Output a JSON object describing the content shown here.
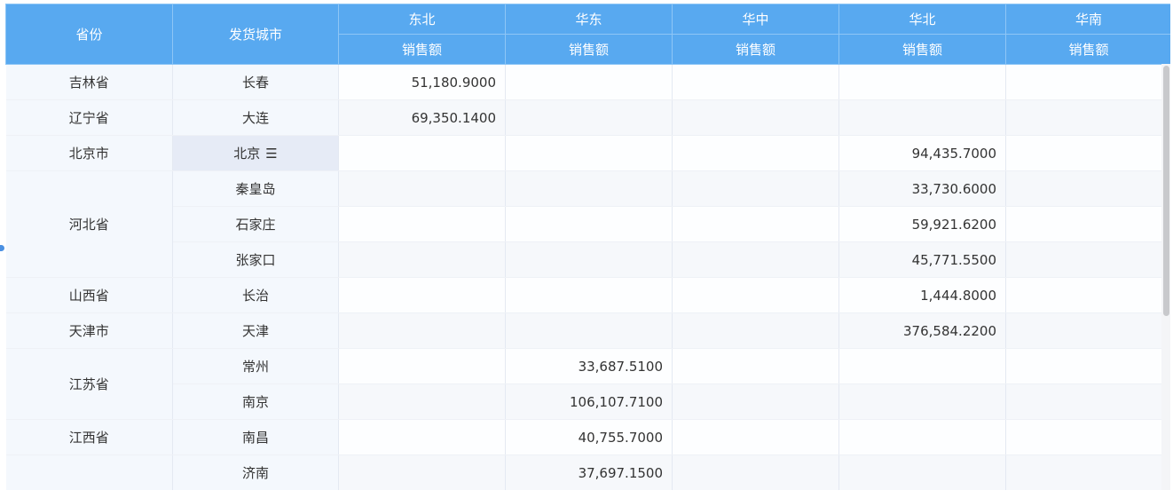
{
  "header": {
    "province": "省份",
    "city": "发货城市",
    "regions": [
      "东北",
      "华东",
      "华中",
      "华北",
      "华南"
    ],
    "measure": "销售额"
  },
  "rows": [
    {
      "province": "吉林省",
      "city": "长春",
      "values": [
        "51,180.9000",
        "",
        "",
        "",
        ""
      ]
    },
    {
      "province": "辽宁省",
      "city": "大连",
      "values": [
        "69,350.1400",
        "",
        "",
        "",
        ""
      ]
    },
    {
      "province": "北京市",
      "city": "北京",
      "values": [
        "",
        "",
        "",
        "94,435.7000",
        ""
      ]
    },
    {
      "province": "河北省",
      "city": "秦皇岛",
      "values": [
        "",
        "",
        "",
        "33,730.6000",
        ""
      ]
    },
    {
      "province": "",
      "city": "石家庄",
      "values": [
        "",
        "",
        "",
        "59,921.6200",
        ""
      ]
    },
    {
      "province": "",
      "city": "张家口",
      "values": [
        "",
        "",
        "",
        "45,771.5500",
        ""
      ]
    },
    {
      "province": "山西省",
      "city": "长治",
      "values": [
        "",
        "",
        "",
        "1,444.8000",
        ""
      ]
    },
    {
      "province": "天津市",
      "city": "天津",
      "values": [
        "",
        "",
        "",
        "376,584.2200",
        ""
      ]
    },
    {
      "province": "江苏省",
      "city": "常州",
      "values": [
        "",
        "33,687.5100",
        "",
        "",
        ""
      ]
    },
    {
      "province": "",
      "city": "南京",
      "values": [
        "",
        "106,107.7100",
        "",
        "",
        ""
      ]
    },
    {
      "province": "江西省",
      "city": "南昌",
      "values": [
        "",
        "40,755.7000",
        "",
        "",
        ""
      ]
    },
    {
      "province": "",
      "city": "济南",
      "values": [
        "",
        "37,697.1500",
        "",
        "",
        ""
      ]
    }
  ],
  "merges": [
    {
      "startRow": 3,
      "rowspan": 3
    },
    {
      "startRow": 8,
      "rowspan": 2
    }
  ],
  "selected": {
    "row": 2,
    "icon": "menu-icon",
    "glyph": "☰"
  }
}
